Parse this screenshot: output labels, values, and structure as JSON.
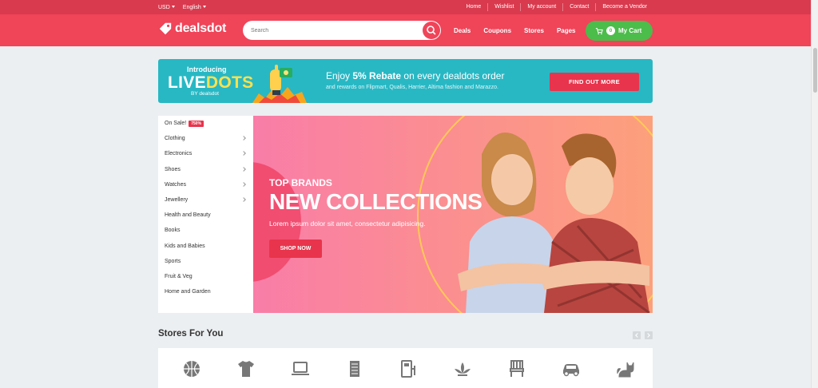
{
  "topbar": {
    "currency": "USD",
    "language": "English",
    "links": [
      "Home",
      "Wishlist",
      "My account",
      "Contact",
      "Become a Vendor"
    ]
  },
  "header": {
    "brand": "dealsdot",
    "search_placeholder": "Search",
    "nav": [
      "Deals",
      "Coupons",
      "Stores",
      "Pages"
    ],
    "cart_count": "0",
    "cart_label": "My Cart"
  },
  "promo": {
    "intro": "Introducing",
    "title_part1": "LIVE",
    "title_part2": "DOTS",
    "by": "BY dealsdot",
    "headline_prefix": "Enjoy ",
    "headline_bold": "5% Rebate",
    "headline_suffix": " on every dealdots order",
    "sub": "and rewards on Flipmart, Qualis, Harrier, Altima fashion and Marazzo.",
    "cta": "FIND OUT MORE"
  },
  "categories": [
    {
      "label": "On Sale!",
      "tag": "750%",
      "arrow": false
    },
    {
      "label": "Clothing",
      "arrow": true
    },
    {
      "label": "Electronics",
      "arrow": true
    },
    {
      "label": "Shoes",
      "arrow": true
    },
    {
      "label": "Watches",
      "arrow": true
    },
    {
      "label": "Jewellery",
      "arrow": true
    },
    {
      "label": "Health and Beauty",
      "arrow": false
    },
    {
      "label": "Books",
      "arrow": false
    },
    {
      "label": "Kids and Babies",
      "arrow": false
    },
    {
      "label": "Sports",
      "arrow": false
    },
    {
      "label": "Fruit & Veg",
      "arrow": false
    },
    {
      "label": "Home and Garden",
      "arrow": false
    }
  ],
  "hero": {
    "eyebrow": "TOP BRANDS",
    "title": "NEW COLLECTIONS",
    "text": "Lorem ipsum dolor sit amet, consectetur adipisicing.",
    "cta": "SHOP NOW"
  },
  "stores": {
    "title": "Stores For You",
    "icons": [
      "basketball-icon",
      "tshirt-icon",
      "laptop-icon",
      "book-stack-icon",
      "appliance-icon",
      "plant-icon",
      "chair-icon",
      "car-icon",
      "cat-icon"
    ]
  },
  "colors": {
    "header": "#f04459",
    "topbar": "#d93a4e",
    "cart": "#4cbc4a",
    "promo": "#28b8c4",
    "accent": "#e8344c"
  }
}
